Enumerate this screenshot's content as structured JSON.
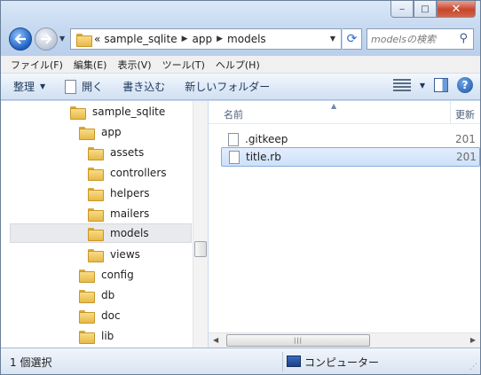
{
  "window": {
    "minimize_label": "‒",
    "maximize_label": "□",
    "close_label": "✕"
  },
  "address": {
    "overflow": "«",
    "crumbs": [
      "sample_sqlite",
      "app",
      "models"
    ]
  },
  "search": {
    "placeholder": "modelsの検索"
  },
  "menubar": {
    "items": [
      "ファイル(F)",
      "編集(E)",
      "表示(V)",
      "ツール(T)",
      "ヘルプ(H)"
    ]
  },
  "toolbar": {
    "organize": "整理",
    "open": "開く",
    "burn": "書き込む",
    "new_folder": "新しいフォルダー"
  },
  "tree": {
    "items": [
      "sample_sqlite",
      "app",
      "assets",
      "controllers",
      "helpers",
      "mailers",
      "models",
      "views",
      "config",
      "db",
      "doc",
      "lib"
    ],
    "selected": "models"
  },
  "columns": {
    "name": "名前",
    "date": "更新"
  },
  "files": [
    {
      "name": ".gitkeep",
      "date": "201"
    },
    {
      "name": "title.rb",
      "date": "201"
    }
  ],
  "status": {
    "selection": "1 個選択",
    "location": "コンピューター"
  },
  "colors": {
    "chrome": "#c6d9f1",
    "selection_border": "#84acdd",
    "folder": "#e7b94a"
  }
}
